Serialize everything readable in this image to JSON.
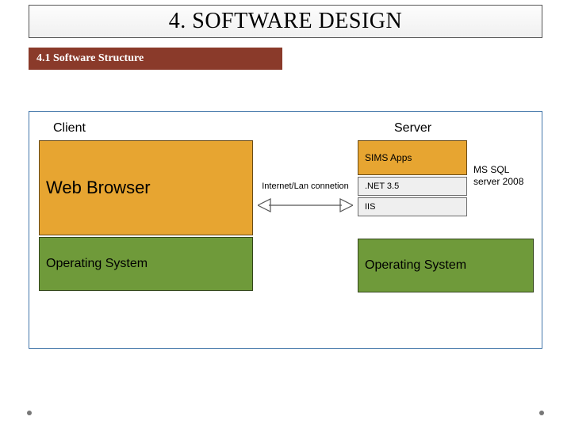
{
  "title": "4. SOFTWARE DESIGN",
  "subhead": "4.1 Software Structure",
  "diagram": {
    "client_label": "Client",
    "server_label": "Server",
    "connection_label": "Internet/Lan connetion",
    "client": {
      "browser": "Web Browser",
      "os": "Operating System"
    },
    "server": {
      "apps": "SIMS Apps",
      "net": ".NET 3.5",
      "iis": "IIS",
      "os": "Operating System",
      "db": "MS SQL server 2008"
    }
  }
}
